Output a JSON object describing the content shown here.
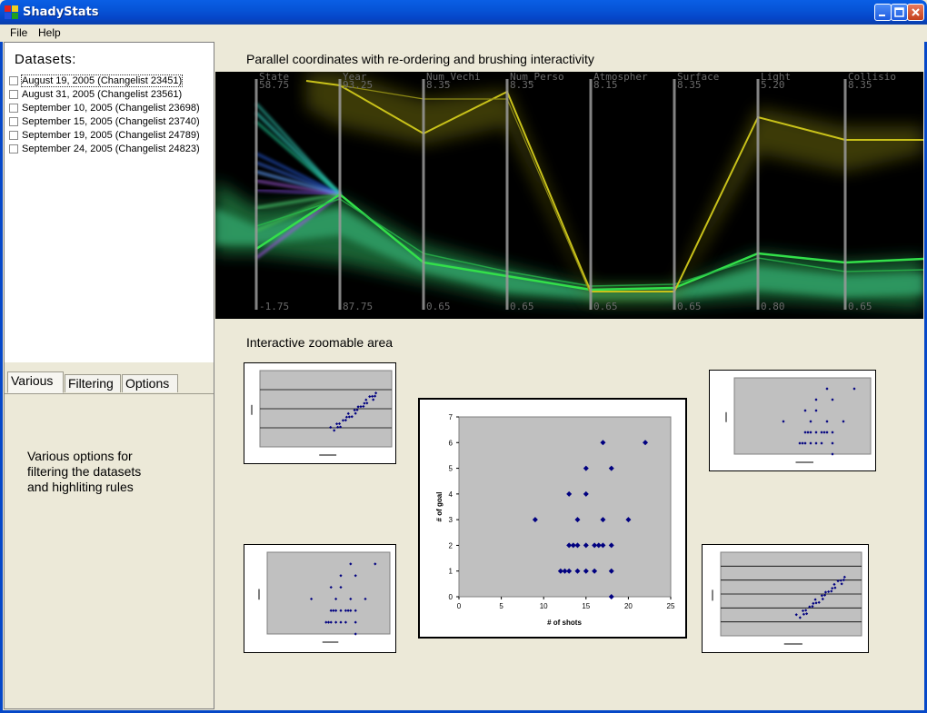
{
  "window": {
    "title": "ShadyStats"
  },
  "menu": {
    "file": "File",
    "help": "Help"
  },
  "datasets": {
    "label": "Datasets:",
    "items": [
      "August 19, 2005 (Changelist 23451)",
      "August 31, 2005 (Changelist 23561)",
      "September 10, 2005 (Changelist 23698)",
      "September 15, 2005 (Changelist 23740)",
      "September 19, 2005 (Changelist 24789)",
      "September 24, 2005 (Changelist 24823)"
    ]
  },
  "tabs": {
    "various": "Various",
    "filtering": "Filtering",
    "options": "Options",
    "various_text": "Various options for\nfiltering the datasets\nand highliting rules"
  },
  "parallel": {
    "title": "Parallel coordinates with re-ordering and brushing interactivity",
    "axes": [
      {
        "name": "State",
        "top": "58.75",
        "bottom": "-1.75"
      },
      {
        "name": "Year",
        "top": "93.25",
        "bottom": "87.75"
      },
      {
        "name": "Num_Vechi",
        "top": "8.35",
        "bottom": "0.65"
      },
      {
        "name": "Num_Perso",
        "top": "8.35",
        "bottom": "0.65"
      },
      {
        "name": "Atmospher",
        "top": "8.15",
        "bottom": "0.65"
      },
      {
        "name": "Surface",
        "top": "8.35",
        "bottom": "0.65"
      },
      {
        "name": "Light",
        "top": "5.20",
        "bottom": "0.80"
      },
      {
        "name": "Collisio",
        "top": "8.35",
        "bottom": "0.65"
      }
    ]
  },
  "zoom": {
    "title": "Interactive zoomable area",
    "main_chart": {
      "xlabel": "# of shots",
      "ylabel": "# of goal",
      "xticks": [
        "0",
        "5",
        "10",
        "15",
        "20",
        "25"
      ],
      "yticks": [
        "0",
        "1",
        "2",
        "3",
        "4",
        "5",
        "6",
        "7"
      ]
    }
  },
  "chart_data": {
    "type": "scatter",
    "title": "",
    "xlabel": "# of shots",
    "ylabel": "# of goal",
    "xlim": [
      0,
      25
    ],
    "ylim": [
      0,
      7
    ],
    "points": [
      [
        9,
        3
      ],
      [
        12,
        1
      ],
      [
        12.5,
        1
      ],
      [
        13,
        2
      ],
      [
        13,
        4
      ],
      [
        13,
        1
      ],
      [
        13.5,
        2
      ],
      [
        14,
        1
      ],
      [
        14,
        3
      ],
      [
        14,
        2
      ],
      [
        15,
        5
      ],
      [
        15,
        2
      ],
      [
        15,
        4
      ],
      [
        15,
        1
      ],
      [
        16,
        2
      ],
      [
        16,
        1
      ],
      [
        16.5,
        2
      ],
      [
        17,
        3
      ],
      [
        17,
        2
      ],
      [
        17,
        6
      ],
      [
        18,
        2
      ],
      [
        18,
        1
      ],
      [
        18,
        0
      ],
      [
        18,
        5
      ],
      [
        20,
        3
      ],
      [
        22,
        6
      ]
    ]
  }
}
